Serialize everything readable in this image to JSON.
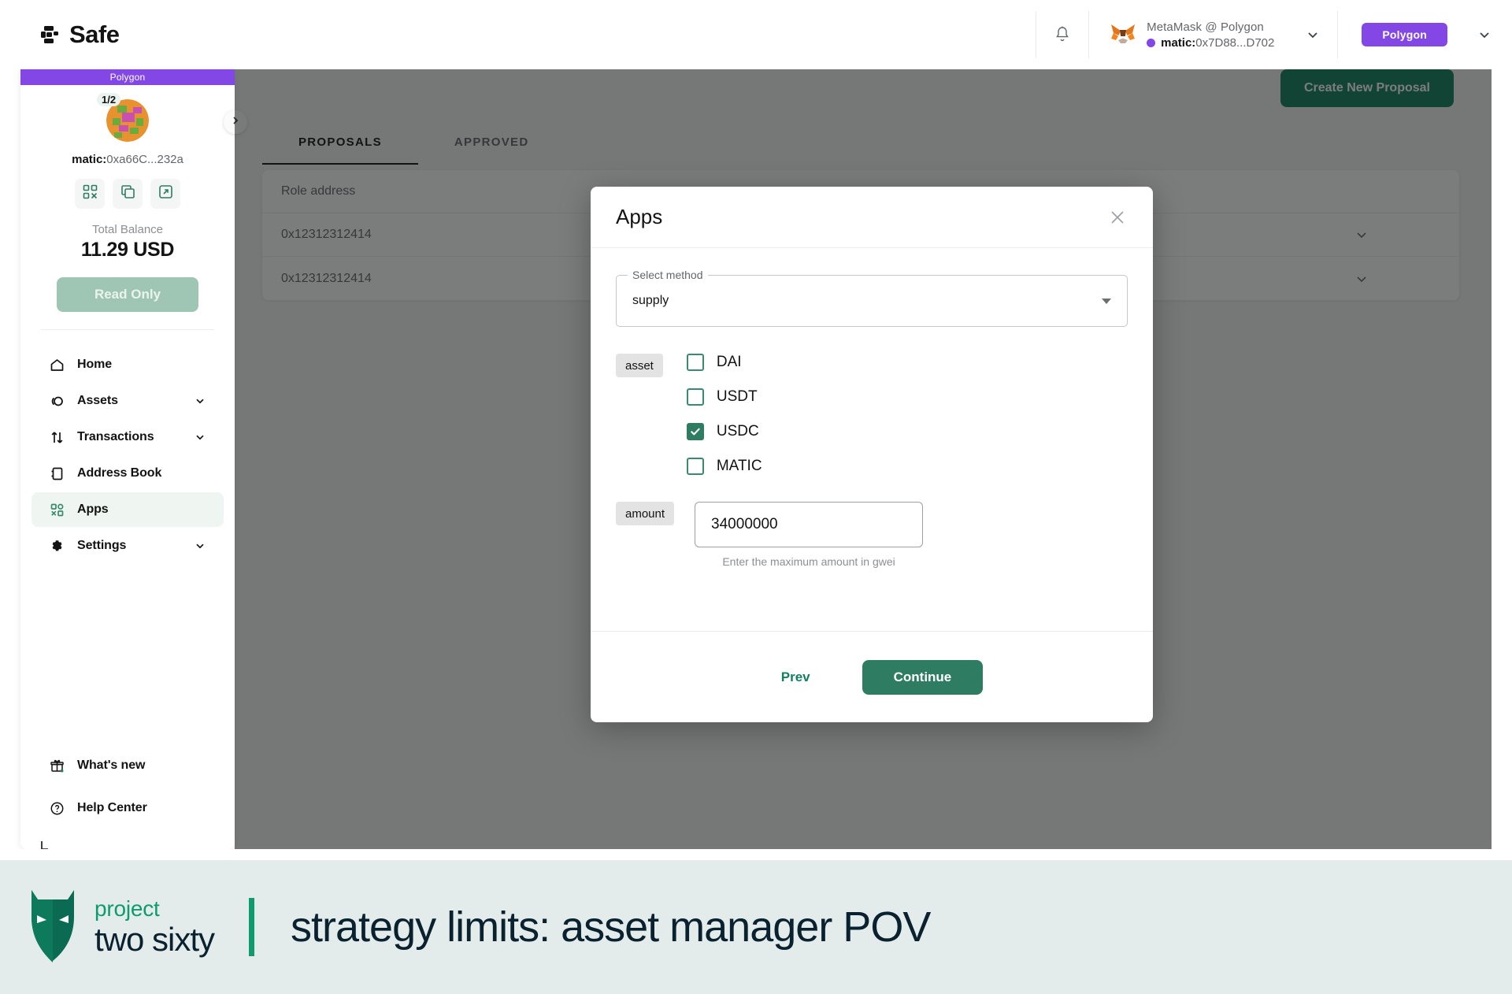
{
  "app": {
    "brand": "Safe",
    "brand_icon": "safe-logo-icon"
  },
  "topbar": {
    "notifications_icon": "bell-icon",
    "wallet": {
      "icon": "metamask-fox-icon",
      "name": "MetaMask @ Polygon",
      "prefix": "matic:",
      "address": "0x7D88...D702",
      "chevron_icon": "chevron-down-icon",
      "network_dot_color": "#8247e5"
    },
    "network_chip": {
      "label": "Polygon",
      "color": "#8247e5",
      "chevron_icon": "chevron-down-icon"
    }
  },
  "sidebar": {
    "network_banner": "Polygon",
    "threshold_badge": "1/2",
    "avatar_icon": "safe-identicon-avatar",
    "address_prefix": "matic:",
    "address": "0xa66C...232a",
    "actions": [
      {
        "name": "qr-code-icon",
        "label": "QR code"
      },
      {
        "name": "copy-icon",
        "label": "Copy address"
      },
      {
        "name": "external-link-icon",
        "label": "View on explorer"
      }
    ],
    "balance_label": "Total Balance",
    "balance_value": "11.29 USD",
    "readonly_label": "Read Only",
    "collapse_icon": "chevron-right-icon",
    "items": [
      {
        "label": "Home",
        "icon": "home-icon",
        "expandable": false,
        "active": false
      },
      {
        "label": "Assets",
        "icon": "coins-icon",
        "expandable": true,
        "active": false
      },
      {
        "label": "Transactions",
        "icon": "transfer-arrows-icon",
        "expandable": true,
        "active": false
      },
      {
        "label": "Address Book",
        "icon": "address-book-icon",
        "expandable": false,
        "active": false
      },
      {
        "label": "Apps",
        "icon": "apps-grid-icon",
        "expandable": false,
        "active": true
      },
      {
        "label": "Settings",
        "icon": "gear-icon",
        "expandable": true,
        "active": false
      }
    ],
    "bottom_items": [
      {
        "label": "What's new",
        "icon": "gift-icon"
      },
      {
        "label": "Help Center",
        "icon": "question-circle-icon"
      }
    ]
  },
  "main": {
    "create_button": "Create New Proposal",
    "tabs": [
      {
        "label": "PROPOSALS",
        "active": true
      },
      {
        "label": "APPROVED",
        "active": false
      }
    ],
    "table": {
      "header": "Role address",
      "rows": [
        {
          "address": "0x12312312414",
          "chevron_icon": "chevron-down-icon"
        },
        {
          "address": "0x12312312414",
          "chevron_icon": "chevron-down-icon"
        }
      ]
    }
  },
  "modal": {
    "title": "Apps",
    "close_icon": "close-icon",
    "method_field": {
      "legend": "Select method",
      "value": "supply",
      "caret_icon": "caret-down-icon"
    },
    "asset_param": {
      "tag": "asset",
      "options": [
        {
          "label": "DAI",
          "checked": false
        },
        {
          "label": "USDT",
          "checked": false
        },
        {
          "label": "USDC",
          "checked": true
        },
        {
          "label": "MATIC",
          "checked": false
        }
      ]
    },
    "amount_param": {
      "tag": "amount",
      "value": "34000000",
      "placeholder": "",
      "helper": "Enter the maximum amount in gwei"
    },
    "prev_label": "Prev",
    "continue_label": "Continue",
    "accent_color": "#2e7d62"
  },
  "banner": {
    "logo_icon": "project-two-sixty-wolf-icon",
    "logo_line1": "project",
    "logo_line2": "two sixty",
    "title": "strategy limits: asset manager POV",
    "accent_color": "#0f9b6e"
  }
}
